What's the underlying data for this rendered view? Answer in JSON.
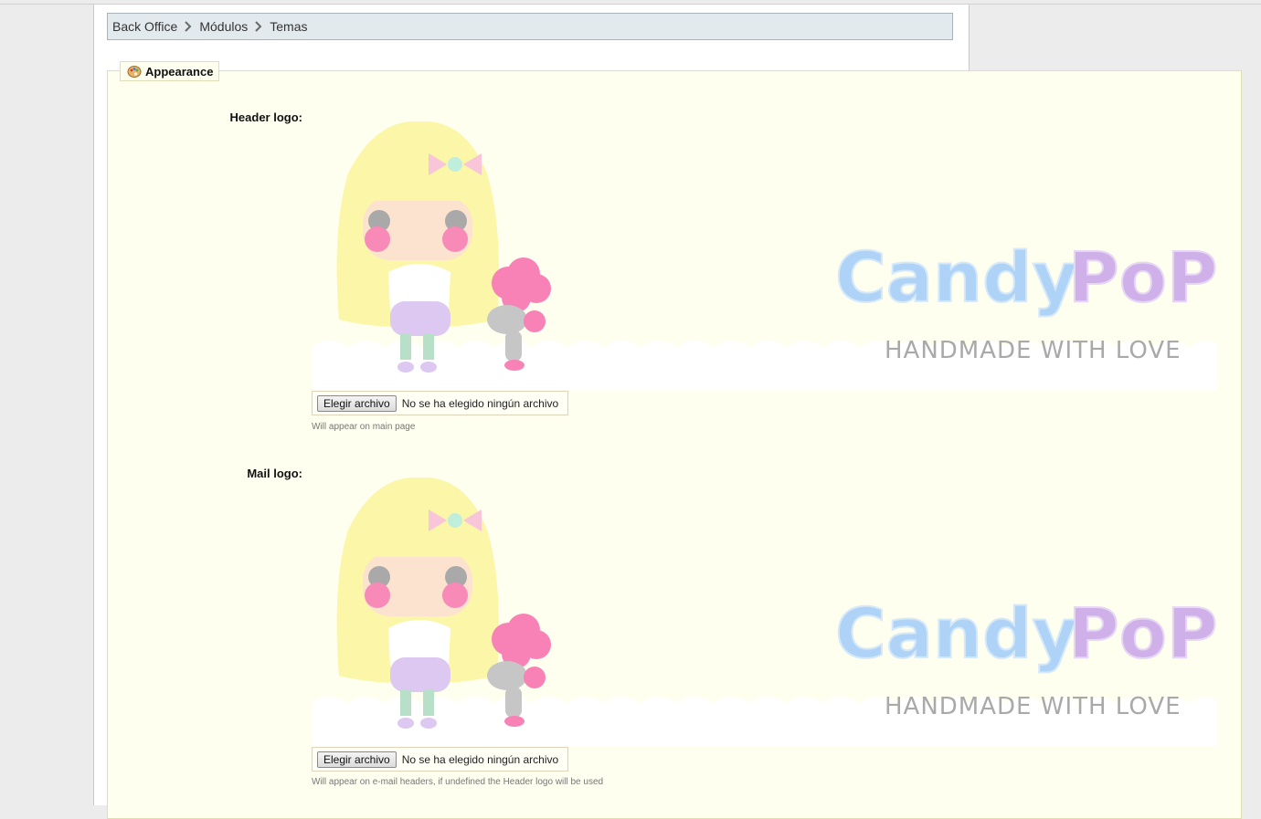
{
  "breadcrumb": {
    "items": [
      "Back Office",
      "Módulos",
      "Temas"
    ]
  },
  "appearance": {
    "legend": "Appearance",
    "legend_icon": "palette-icon",
    "fields": [
      {
        "label": "Header logo:",
        "logo": {
          "title_part1": "Candy",
          "title_part2": "PoP",
          "tagline": "HANDMADE WITH LOVE"
        },
        "file_button": "Elegir archivo",
        "file_status": "No se ha elegido ningún archivo",
        "hint": "Will appear on main page"
      },
      {
        "label": "Mail logo:",
        "logo": {
          "title_part1": "Candy",
          "title_part2": "PoP",
          "tagline": "HANDMADE WITH LOVE"
        },
        "file_button": "Elegir archivo",
        "file_status": "No se ha elegido ningún archivo",
        "hint": "Will appear on e-mail headers, if undefined the Header logo will be used"
      }
    ]
  },
  "colors": {
    "fieldset_bg": "#fffff0",
    "breadcrumb_bg": "#e3eaee",
    "candy_blue": "#aed3f7",
    "pop_purple": "#cfb0e8"
  }
}
